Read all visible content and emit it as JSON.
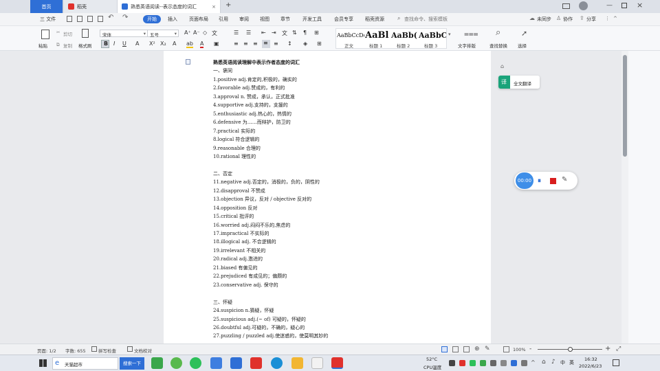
{
  "tabs": {
    "home": "首页",
    "t1": "稻壳",
    "t2": "熟悉英语阅读--表示态度的词汇",
    "add": "+"
  },
  "menu": {
    "file": "三 文件",
    "items": [
      "开始",
      "插入",
      "页面布局",
      "引用",
      "审阅",
      "视图",
      "章节",
      "开发工具",
      "会员专享",
      "稻壳资源"
    ],
    "search": "查找命令、搜索模板",
    "sync": "未同步",
    "collab": "协作",
    "share": "分享"
  },
  "ribbon": {
    "paste": "粘贴",
    "cut": "剪切",
    "copy": "复制",
    "format_painter": "格式刷",
    "font": "宋体",
    "size": "五号",
    "styles": [
      {
        "sample": "AaBbCcDd",
        "label": "正文"
      },
      {
        "sample": "AaBl",
        "label": "标题 1"
      },
      {
        "sample": "AaBb(",
        "label": "标题 2"
      },
      {
        "sample": "AaBbC",
        "label": "标题 3"
      }
    ],
    "text_layout": "文字排版",
    "find_replace": "查找替换",
    "select": "选择"
  },
  "doc": {
    "lines": [
      "熟悉英语阅读理解中表示作者态度的词汇",
      "一、褒同",
      "1.positive    adj.肯定的,积极的，确实的",
      "2.favorable   adj.赞成的，有利的",
      "3.approval   n. 赞成，承认，正式批准",
      "4.supportive   adj.支持的，支援的",
      "5.enthusiastic    adj.热心的，热情的",
      "6.defensive 为……而辩护，防卫的",
      "7.practical 实际的",
      "8.logical 符合逻辑的",
      "9.reasonable 合理的",
      "10.rational 理性的",
      "",
      "二、否定",
      "11.negative    adj.否定的，消极的，负的，阴性的",
      "12.disapproval 不赞成",
      "13.objection 异议，反对 / objective 反对的",
      "14.opposition 反对",
      "15.critical 批评的",
      "16.worried    adj.闷闷不乐的,焦虑的",
      "17.impractical   不实际的",
      "18.illogical adj. 不合逻辑的",
      "19.irrelevant 不相关的",
      "20.radical    adj.激进的",
      "21.biased 有偏见的",
      "22.prejudiced 有成见的；偏颇的",
      "23.conservative adj. 保守的",
      "",
      "三、怀疑",
      "24.suspicion    n.猜疑，怀疑",
      "25.suspicious    adj.(~ of) 可疑的，怀疑的",
      "26.doubtful    adj.可疑的，不确的，疑心的",
      "27.puzzling / puzzled adj.使迷惑的，使莫明其妙的"
    ]
  },
  "side": {
    "translate": "全文翻译",
    "timer": "00:00"
  },
  "status": {
    "page": "页面: 1/2",
    "words": "字数: 655",
    "spell": "拼写检查",
    "proof": "文档校对",
    "zoom": "100%",
    "minus": "-",
    "plus": "+"
  },
  "taskbar": {
    "browser": "天猫超市",
    "search": "搜索一下",
    "temp": "52°C",
    "cpu": "CPU温度",
    "lang": "中",
    "ime": "英",
    "time": "16:32",
    "date": "2022/6/23"
  },
  "colors": {
    "accent": "#2f6fd6",
    "translate": "#1aa37a",
    "record": "#d81e1e",
    "wps_red": "#e0312c"
  }
}
